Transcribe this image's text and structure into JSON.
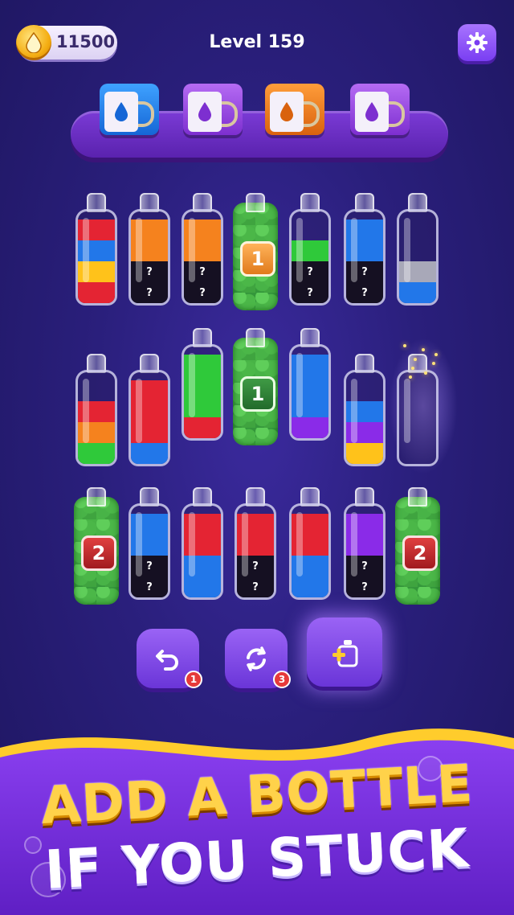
{
  "hud": {
    "coins": "11500",
    "level": "Level 159"
  },
  "colors": {
    "red": "#e42433",
    "orange": "#f5821e",
    "yellow": "#ffc21a",
    "blue": "#2277e9",
    "green": "#2fc93a",
    "purple": "#8a2be8",
    "black": "#151022",
    "grey": "#a8a8b8",
    "empty": "transparent"
  },
  "boxes": [
    {
      "color": "blue",
      "icon": "water-drop-icon"
    },
    {
      "color": "purple",
      "icon": "water-drop-icon"
    },
    {
      "color": "orange",
      "icon": "water-drop-icon"
    },
    {
      "color": "purple",
      "icon": "water-drop-icon"
    }
  ],
  "rows": [
    [
      {
        "type": "bottle",
        "segments": [
          [
            "red",
            null
          ],
          [
            "yellow",
            null
          ],
          [
            "blue",
            null
          ],
          [
            "red",
            null
          ]
        ]
      },
      {
        "type": "bottle",
        "segments": [
          [
            "black",
            "?"
          ],
          [
            "black",
            "?"
          ],
          [
            "orange",
            null
          ],
          [
            "orange",
            null
          ]
        ]
      },
      {
        "type": "bottle",
        "segments": [
          [
            "black",
            "?"
          ],
          [
            "black",
            "?"
          ],
          [
            "orange",
            null
          ],
          [
            "orange",
            null
          ]
        ]
      },
      {
        "type": "locked",
        "tag": "1",
        "tagColor": "orange"
      },
      {
        "type": "bottle",
        "segments": [
          [
            "black",
            "?"
          ],
          [
            "black",
            "?"
          ],
          [
            "green",
            null
          ]
        ]
      },
      {
        "type": "bottle",
        "segments": [
          [
            "black",
            "?"
          ],
          [
            "black",
            "?"
          ],
          [
            "blue",
            null
          ],
          [
            "blue",
            null
          ]
        ]
      },
      {
        "type": "bottle",
        "segments": [
          [
            "blue",
            null
          ],
          [
            "grey",
            null
          ]
        ]
      }
    ],
    [
      {
        "type": "bottle",
        "segments": [
          [
            "green",
            null
          ],
          [
            "orange",
            null
          ],
          [
            "red",
            null
          ]
        ]
      },
      {
        "type": "bottle",
        "segments": [
          [
            "blue",
            null
          ],
          [
            "red",
            null
          ],
          [
            "red",
            null
          ],
          [
            "red",
            null
          ]
        ]
      },
      {
        "type": "bottle",
        "segments": [
          [
            "red",
            null
          ],
          [
            "green",
            null
          ],
          [
            "green",
            null
          ],
          [
            "green",
            null
          ]
        ]
      },
      {
        "type": "locked",
        "tag": "1",
        "tagColor": "green"
      },
      {
        "type": "bottle",
        "segments": [
          [
            "purple",
            null
          ],
          [
            "blue",
            null
          ],
          [
            "blue",
            null
          ],
          [
            "blue",
            null
          ]
        ]
      },
      {
        "type": "bottle",
        "segments": [
          [
            "yellow",
            null
          ],
          [
            "purple",
            null
          ],
          [
            "blue",
            null
          ]
        ]
      },
      {
        "type": "bottle",
        "segments": [],
        "sparkle": true
      }
    ],
    [
      {
        "type": "locked",
        "tag": "2",
        "tagColor": "red"
      },
      {
        "type": "bottle",
        "segments": [
          [
            "black",
            "?"
          ],
          [
            "black",
            "?"
          ],
          [
            "blue",
            null
          ],
          [
            "blue",
            null
          ]
        ]
      },
      {
        "type": "bottle",
        "segments": [
          [
            "blue",
            null
          ],
          [
            "blue",
            null
          ],
          [
            "red",
            null
          ],
          [
            "red",
            null
          ]
        ]
      },
      {
        "type": "bottle",
        "segments": [
          [
            "black",
            "?"
          ],
          [
            "black",
            "?"
          ],
          [
            "red",
            null
          ],
          [
            "red",
            null
          ]
        ]
      },
      {
        "type": "bottle",
        "segments": [
          [
            "blue",
            null
          ],
          [
            "blue",
            null
          ],
          [
            "red",
            null
          ],
          [
            "red",
            null
          ]
        ]
      },
      {
        "type": "bottle",
        "segments": [
          [
            "black",
            "?"
          ],
          [
            "black",
            "?"
          ],
          [
            "purple",
            null
          ],
          [
            "purple",
            null
          ]
        ]
      },
      {
        "type": "locked",
        "tag": "2",
        "tagColor": "red"
      }
    ]
  ],
  "tools": [
    {
      "name": "undo-button",
      "icon": "undo-icon",
      "count": "1"
    },
    {
      "name": "shuffle-button",
      "icon": "shuffle-icon",
      "count": "3"
    },
    {
      "name": "add-bottle-button",
      "icon": "add-bottle-icon",
      "count": ""
    }
  ],
  "banner": {
    "line1": "ADD A BOTTLE",
    "line2": "IF YOU STUCK"
  }
}
